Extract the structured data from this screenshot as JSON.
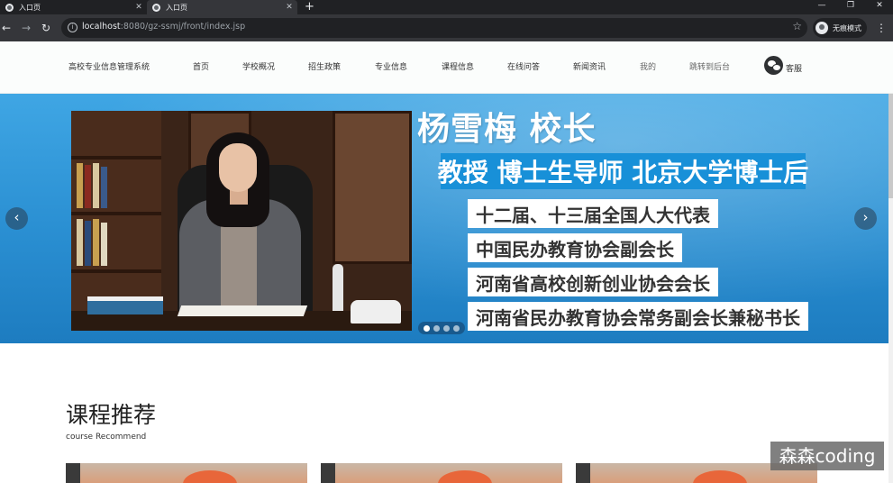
{
  "browser": {
    "tabs": [
      {
        "title": "入口页",
        "active": false
      },
      {
        "title": "入口页",
        "active": true
      }
    ],
    "new_tab_glyph": "+",
    "url_host": "localhost",
    "url_rest": ":8080/gz-ssmj/front/index.jsp",
    "profile_label": "无痕模式",
    "icons": [
      "globe-icon",
      "close-icon",
      "plus-icon",
      "back-icon",
      "forward-icon",
      "reload-icon",
      "info-icon",
      "star-icon",
      "incognito-icon",
      "kebab-icon",
      "minimize-icon",
      "restore-icon"
    ]
  },
  "header": {
    "brand": "高校专业信息管理系统",
    "nav": [
      "首页",
      "学校概况",
      "招生政策",
      "专业信息",
      "课程信息",
      "在线问答",
      "新闻资讯",
      "我的",
      "跳转到后台"
    ],
    "service_label": "客服"
  },
  "carousel": {
    "headline": "杨雪梅 校长",
    "subtitle": "教授 博士生导师 北京大学博士后",
    "titles": [
      "十二届、十三届全国人大代表",
      "中国民办教育协会副会长",
      "河南省高校创新创业协会会长",
      "河南省民办教育协会常务副会长兼秘书长"
    ],
    "slide_count": 4,
    "active_slide": 1,
    "accent": "#1890d8"
  },
  "section": {
    "title": "课程推荐",
    "subtitle": "course Recommend"
  },
  "watermark": "森森coding"
}
